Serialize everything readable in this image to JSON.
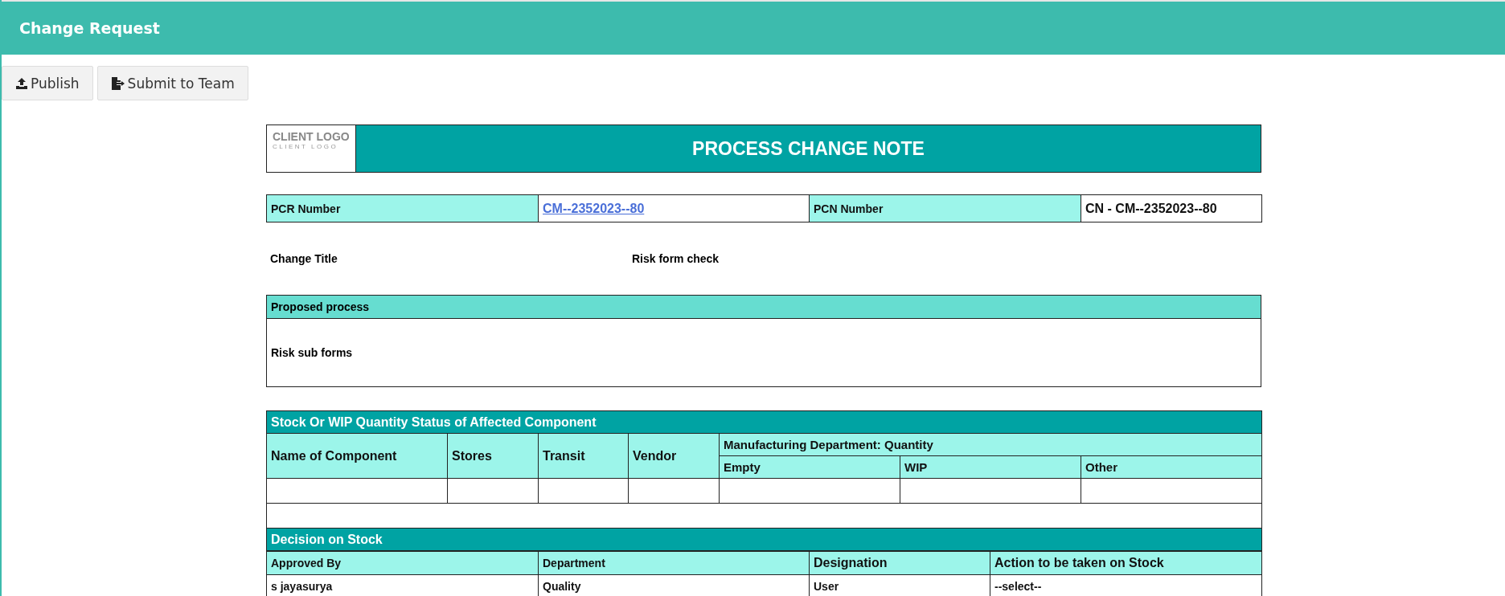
{
  "header": {
    "title": "Change Request"
  },
  "toolbar": [
    {
      "label": "Publish",
      "kind": "publish"
    },
    {
      "label": "Submit to Team",
      "kind": "submit"
    }
  ],
  "note": {
    "logo_text": "CLIENT LOGO",
    "logo_subtext": "CLIENT LOGO",
    "title": "PROCESS CHANGE NOTE"
  },
  "numbers": [
    {
      "label": "PCR Number",
      "value": "CM--2352023--80",
      "kind": "link"
    },
    {
      "label": "PCN Number",
      "value": "CN - CM--2352023--80",
      "kind": "text"
    }
  ],
  "fields": [
    "Change Title",
    "Risk form check"
  ],
  "proposed": {
    "title": "Proposed process",
    "body": "Risk sub forms"
  },
  "stock": {
    "title": "Stock Or WIP Quantity Status of Affected Component",
    "columns": [
      "Name of Component",
      "Stores",
      "Transit",
      "Vendor"
    ],
    "group": {
      "label": "Manufacturing Department: Quantity",
      "columns": [
        "Empty",
        "WIP",
        "Other"
      ]
    }
  },
  "decision": {
    "title": "Decision on Stock",
    "columns": [
      "Approved By",
      "Department",
      "Designation",
      "Action to be taken on Stock"
    ],
    "rows": [
      [
        "s jayasurya",
        "Quality",
        "User",
        "--select--"
      ]
    ]
  }
}
